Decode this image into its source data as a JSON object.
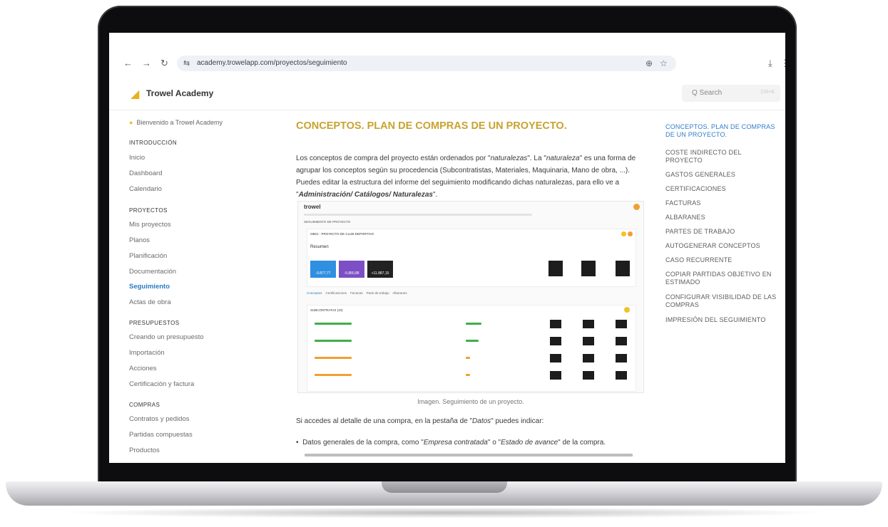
{
  "browser": {
    "back_icon": "←",
    "forward_icon": "→",
    "reload_icon": "↻",
    "site_info_icon": "⇆",
    "url": "academy.trowelapp.com/proyectos/seguimiento",
    "zoom_icon": "⊕",
    "bookmark_icon": "☆",
    "download_icon": "⤓",
    "menu_icon": "⋮"
  },
  "header": {
    "logo_icon": "◢",
    "site_title": "Trowel Academy",
    "search_placeholder": "Q  Search",
    "search_shortcut": "Ctrl+K"
  },
  "sidebar": {
    "welcome_icon": "●",
    "welcome": "Bienvenido a Trowel Academy",
    "sections": [
      {
        "title": "INTRODUCCIÓN",
        "items": [
          "Inicio",
          "Dashboard",
          "Calendario"
        ]
      },
      {
        "title": "PROYECTOS",
        "items": [
          "Mis proyectos",
          "Planos",
          "Planificación",
          "Documentación",
          "Seguimiento",
          "Actas de obra"
        ]
      },
      {
        "title": "PRESUPUESTOS",
        "items": [
          "Creando un presupuesto",
          "Importación",
          "Acciones",
          "Certificación y factura"
        ]
      },
      {
        "title": "COMPRAS",
        "items": [
          "Contratos y pedidos",
          "Partidas compuestas",
          "Productos"
        ]
      }
    ],
    "active_item": "Seguimiento"
  },
  "main": {
    "title": "CONCEPTOS. PLAN DE COMPRAS DE UN PROYECTO.",
    "p1_a": "Los conceptos de compra del proyecto están ordenados por \"",
    "p1_b": "naturalezas",
    "p1_c": "\". La \"",
    "p1_d": "naturaleza",
    "p1_e": "\" es una forma de agrupar los conceptos según su procedencia (Subcontratistas, Materiales, Maquinaria, Mano de obra, ...). Puedes editar la estructura del informe del seguimiento modificando dichas naturalezas, para ello ve a \"",
    "p1_f": "Administración/ Catálogos/ Naturalezas",
    "p1_g": "\".",
    "caption": "Imagen. Seguimiento de un proyecto.",
    "p2_a": "Si accedes al detalle de una compra, en la pestaña de \"",
    "p2_b": "Datos",
    "p2_c": "\" puedes indicar:",
    "bullet_a": "Datos generales de la compra, como \"",
    "bullet_b": "Empresa contratada",
    "bullet_c": "\" o \"",
    "bullet_d": "Estado de avance",
    "bullet_e": "\" de la compra."
  },
  "screenshot": {
    "brand": "trowel",
    "breadcrumb": "SEGUIMIENTO DE PROYECTO",
    "project": "OB01 - PROYECTO DE CLUB DEPORTIVO",
    "resumen": "Resumen",
    "kpis": [
      "-9.877,77",
      "-5.880,88",
      "+11.887,15"
    ],
    "tabs": [
      "Conceptos",
      "Certificaciones",
      "Facturas",
      "Parte de trabajo",
      "Albaranes"
    ],
    "group": "SUBCONTRATAS (10)"
  },
  "toc": {
    "items": [
      "CONCEPTOS. PLAN DE COMPRAS DE UN PROYECTO.",
      "COSTE INDIRECTO DEL PROYECTO",
      "GASTOS GENERALES",
      "CERTIFICACIONES",
      "FACTURAS",
      "ALBARANES",
      "PARTES DE TRABAJO",
      "AUTOGENERAR CONCEPTOS",
      "CASO RECURRENTE",
      "COPIAR PARTIDAS OBJETIVO EN ESTIMADO",
      "CONFIGURAR VISIBILIDAD DE LAS COMPRAS",
      "IMPRESIÓN DEL SEGUIMIENTO"
    ],
    "active_index": 0
  },
  "colors": {
    "accent_title": "#c9a22f",
    "link_active": "#2b7ac4",
    "kpi_blue": "#2f8fe0",
    "kpi_purple": "#7c4fc4",
    "kpi_dark": "#222222",
    "progress_green": "#3fae4a",
    "progress_orange": "#f0a030"
  }
}
